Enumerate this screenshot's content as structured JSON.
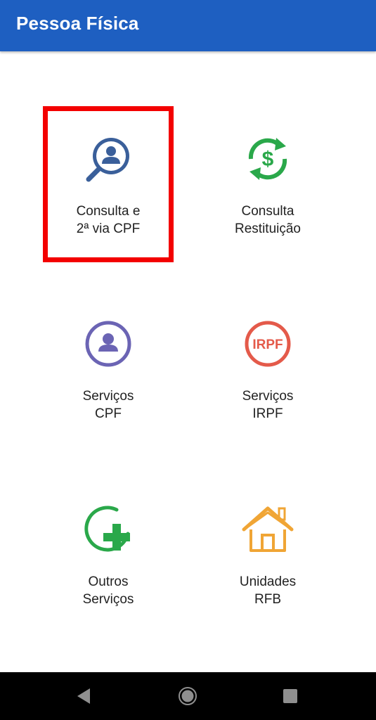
{
  "app_bar": {
    "title": "Pessoa Física",
    "color": "#1e5fc1"
  },
  "tiles": [
    {
      "id": "consulta-cpf",
      "icon": "search-person-icon",
      "line1": "Consulta e",
      "line2": "2ª via CPF",
      "color": "#3a5f9a",
      "highlighted": true
    },
    {
      "id": "consulta-restituicao",
      "icon": "refund-dollar-icon",
      "line1": "Consulta",
      "line2": "Restituição",
      "color": "#2aa84a"
    },
    {
      "id": "servicos-cpf",
      "icon": "person-circle-icon",
      "line1": "Serviços",
      "line2": "CPF",
      "color": "#6b64b4"
    },
    {
      "id": "servicos-irpf",
      "icon": "irpf-circle-icon",
      "icon_text": "IRPF",
      "line1": "Serviços",
      "line2": "IRPF",
      "color": "#e45a4a"
    },
    {
      "id": "outros-servicos",
      "icon": "circle-plus-icon",
      "line1": "Outros",
      "line2": "Serviços",
      "color": "#2aa84a"
    },
    {
      "id": "unidades-rfb",
      "icon": "house-icon",
      "line1": "Unidades",
      "line2": "RFB",
      "color": "#f0a535"
    }
  ],
  "highlight": {
    "color": "#f30000"
  },
  "nav_bar": {
    "back": "back-triangle-icon",
    "home": "home-circle-icon",
    "recents": "recents-square-icon"
  }
}
